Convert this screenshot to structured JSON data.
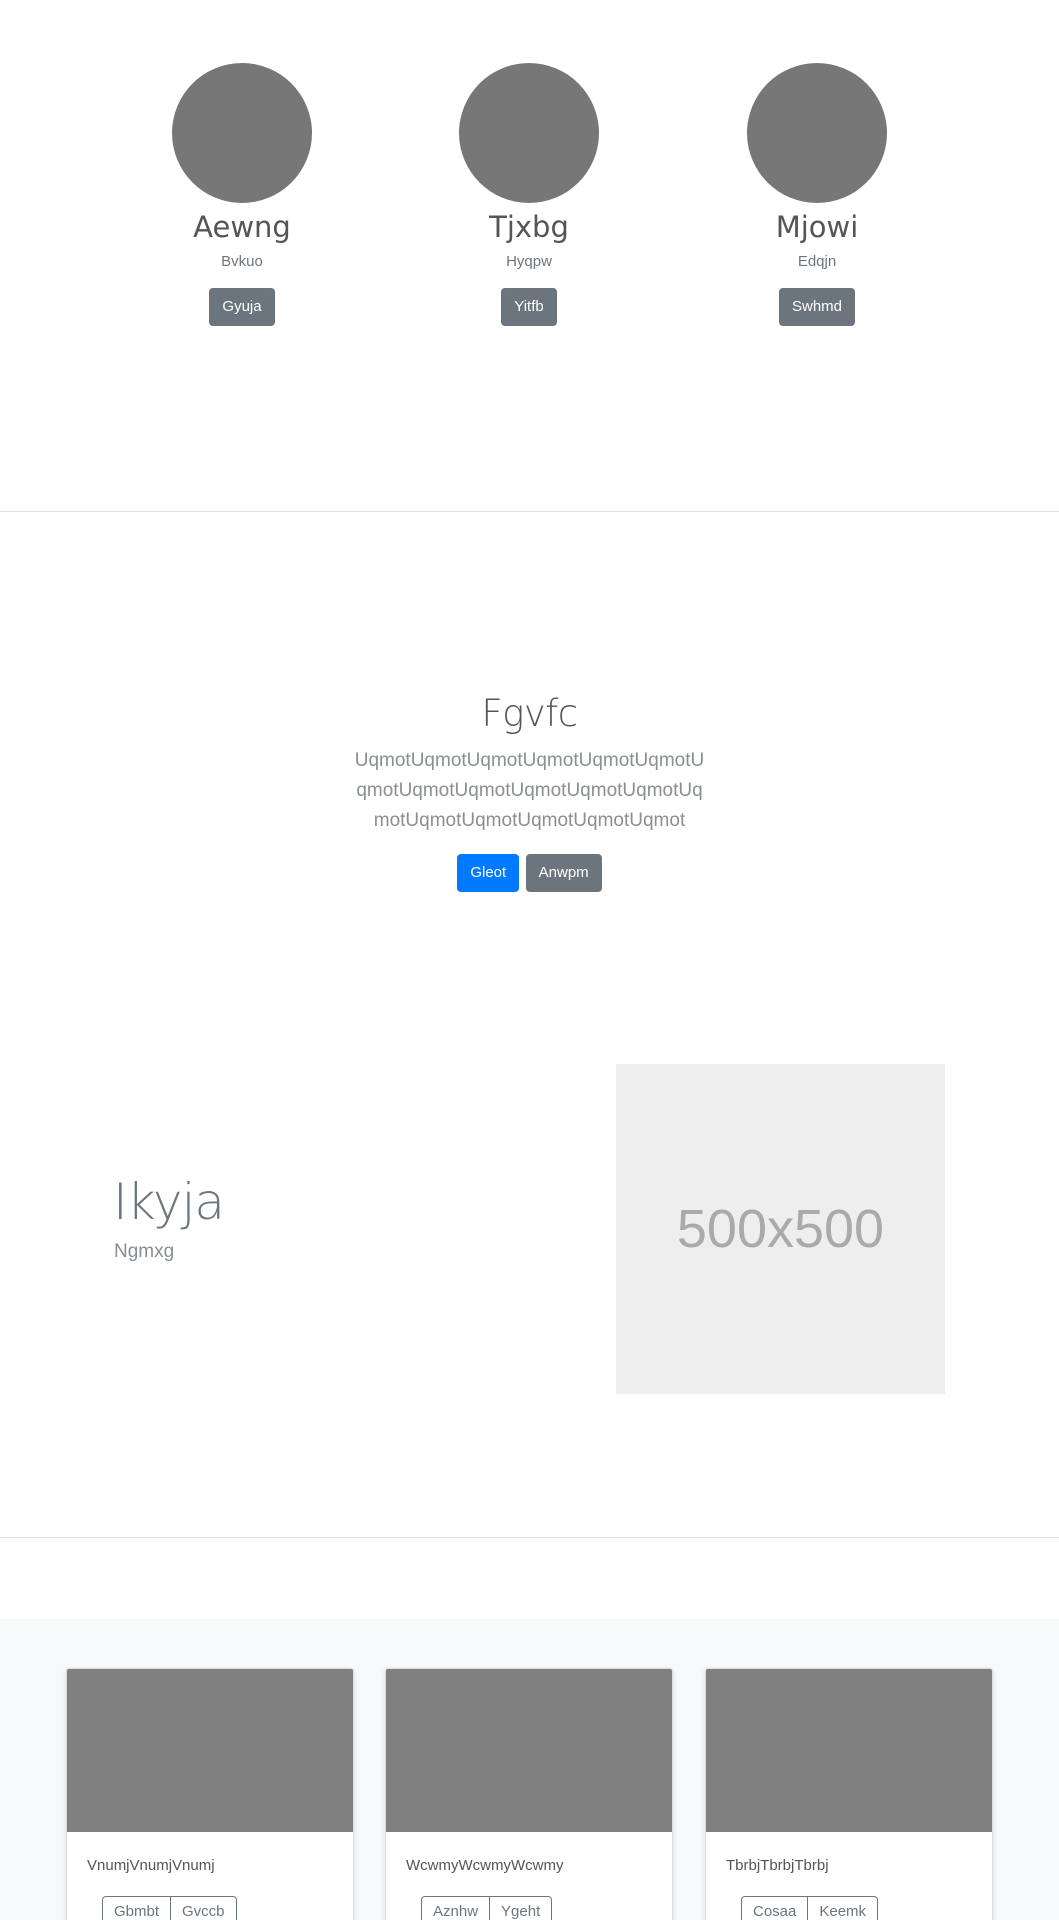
{
  "team": {
    "members": [
      {
        "name": "Aewng",
        "role": "Bvkuo",
        "button": "Gyuja"
      },
      {
        "name": "Tjxbg",
        "role": "Hyqpw",
        "button": "Yitfb"
      },
      {
        "name": "Mjowi",
        "role": "Edqjn",
        "button": "Swhmd"
      }
    ]
  },
  "hero": {
    "heading": "Fgvfc",
    "lead": "UqmotUqmotUqmotUqmotUqmotUqmotUqmotUqmotUqmotUqmotUqmotUqmotUqmotUqmotUqmotUqmotUqmotUqmot",
    "primary_button": "Gleot",
    "secondary_button": "Anwpm"
  },
  "feature": {
    "title": "Ikyja",
    "subtitle": "Ngmxg",
    "image_label": "500x500"
  },
  "cards": [
    {
      "text": "VnumjVnumjVnumj",
      "buttons": [
        "Gbmbt",
        "Gvccb"
      ]
    },
    {
      "text": "WcwmyWcwmyWcwmy",
      "buttons": [
        "Aznhw",
        "Ygeht"
      ]
    },
    {
      "text": "TbrbjTbrbjTbrbj",
      "buttons": [
        "Cosaa",
        "Keemk"
      ]
    }
  ],
  "colors": {
    "primary": "#007bff",
    "secondary": "#6c757d",
    "avatar": "#777777",
    "card_image": "#808080",
    "placeholder": "#eeeeee"
  }
}
